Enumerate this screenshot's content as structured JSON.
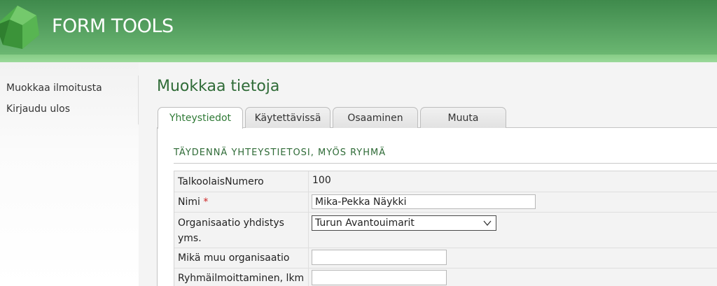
{
  "header": {
    "logo_text": "FORM TOOLS",
    "brand_color": "#5aa564"
  },
  "sidebar": {
    "items": [
      {
        "label": "Muokkaa ilmoitusta"
      },
      {
        "label": "Kirjaudu ulos"
      }
    ]
  },
  "main": {
    "title": "Muokkaa tietoja",
    "tabs": [
      {
        "label": "Yhteystiedot",
        "active": true
      },
      {
        "label": "Käytettävissä",
        "active": false
      },
      {
        "label": "Osaaminen",
        "active": false
      },
      {
        "label": "Muuta",
        "active": false
      }
    ],
    "section_heading": "TÄYDENNÄ YHTEYSTIETOSI, MYÖS RYHMÄ",
    "fields": {
      "number_label": "TalkoolaisNumero",
      "number_value": "100",
      "name_label": "Nimi",
      "name_required_mark": "*",
      "name_value": "Mika-Pekka Näykki",
      "org_label_line1": "Organisaatio yhdistys",
      "org_label_line2": "yms.",
      "org_selected": "Turun Avantouimarit",
      "other_org_label": "Mikä muu organisaatio",
      "other_org_value": "",
      "group_count_label": "Ryhmäilmoittaminen, lkm",
      "group_count_value": ""
    }
  }
}
